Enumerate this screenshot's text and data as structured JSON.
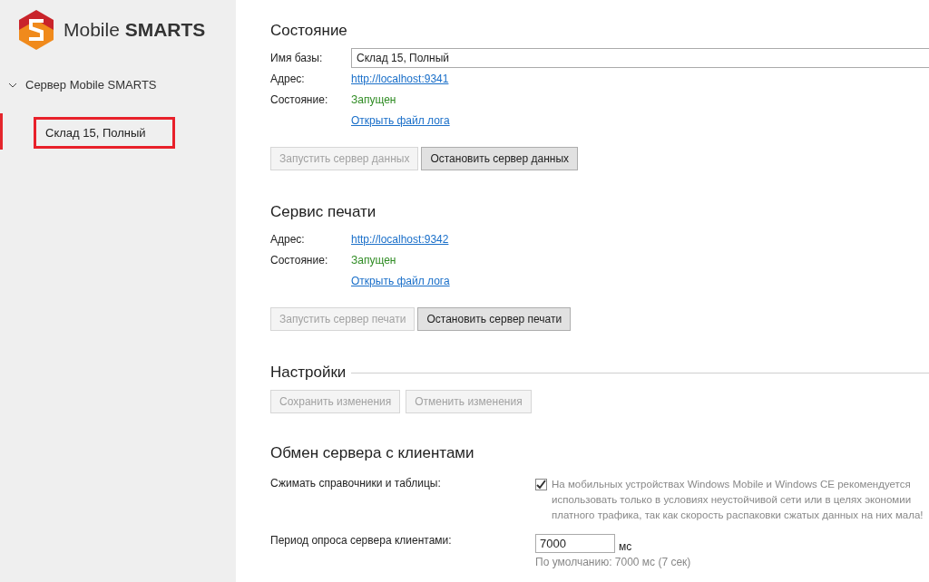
{
  "logo": {
    "light": "Mobile ",
    "bold": "SMARTS"
  },
  "tree": {
    "label": "Сервер Mobile SMARTS",
    "expanded": true,
    "children": [
      {
        "label": "Склад 15, Полный",
        "selected": true
      }
    ]
  },
  "state_section": {
    "title": "Состояние",
    "rows": [
      {
        "kind": "field",
        "label": "Имя базы:",
        "value": "Склад 15, Полный"
      },
      {
        "kind": "link",
        "label": "Адрес:",
        "value": "http://localhost:9341"
      },
      {
        "kind": "status",
        "label": "Состояние:",
        "value": "Запущен"
      },
      {
        "kind": "link",
        "label": "",
        "value": "Открыть файл лога"
      }
    ],
    "buttons": [
      {
        "label": "Запустить сервер данных",
        "disabled": true
      },
      {
        "label": "Остановить сервер данных",
        "disabled": false
      }
    ]
  },
  "print_section": {
    "title": "Сервис печати",
    "rows": [
      {
        "kind": "link",
        "label": "Адрес:",
        "value": "http://localhost:9342"
      },
      {
        "kind": "status",
        "label": "Состояние:",
        "value": "Запущен"
      },
      {
        "kind": "link",
        "label": "",
        "value": "Открыть файл лога"
      }
    ],
    "buttons": [
      {
        "label": "Запустить сервер печати",
        "disabled": true
      },
      {
        "label": "Остановить сервер печати",
        "disabled": false
      }
    ]
  },
  "settings": {
    "title": "Настройки",
    "buttons": [
      {
        "label": "Сохранить изменения",
        "disabled": true
      },
      {
        "label": "Отменить изменения",
        "disabled": true
      }
    ]
  },
  "exchange": {
    "title": "Обмен сервера с клиентами",
    "compress": {
      "label": "Сжимать справочники и таблицы:",
      "checked": true,
      "note": "На мобильных устройствах Windows Mobile и Windows CE рекомендуется использовать только в условиях неустойчивой сети или в целях экономии платного трафика, так как скорость распаковки сжатых данных на них мала!"
    },
    "period": {
      "label": "Период опроса сервера клиентами:",
      "value": "7000",
      "unit": "мс",
      "hint": "По умолчанию: 7000 мс (7 сек)"
    }
  }
}
